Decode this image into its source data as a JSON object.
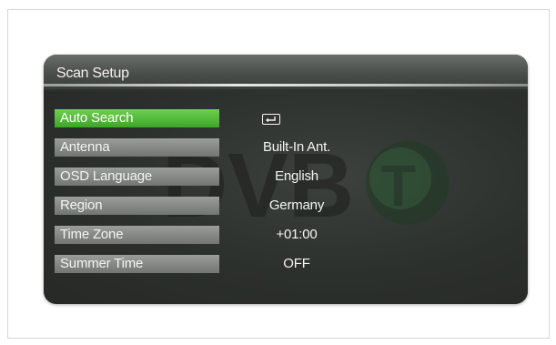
{
  "screen": {
    "title": "Scan Setup"
  },
  "menu": {
    "items": [
      {
        "label": "Auto Search",
        "value": "",
        "selected": true,
        "value_icon": "enter-icon"
      },
      {
        "label": "Antenna",
        "value": "Built-In Ant."
      },
      {
        "label": "OSD Language",
        "value": "English"
      },
      {
        "label": "Region",
        "value": "Germany"
      },
      {
        "label": "Time Zone",
        "value": "+01:00"
      },
      {
        "label": "Summer Time",
        "value": "OFF"
      }
    ]
  },
  "watermark": {
    "icon": "dvb-t-logo",
    "text": "DVB"
  },
  "colors": {
    "panel": "#2e322e",
    "selected": "#4cb935",
    "label": "#858885",
    "text": "#f4f4f4"
  }
}
